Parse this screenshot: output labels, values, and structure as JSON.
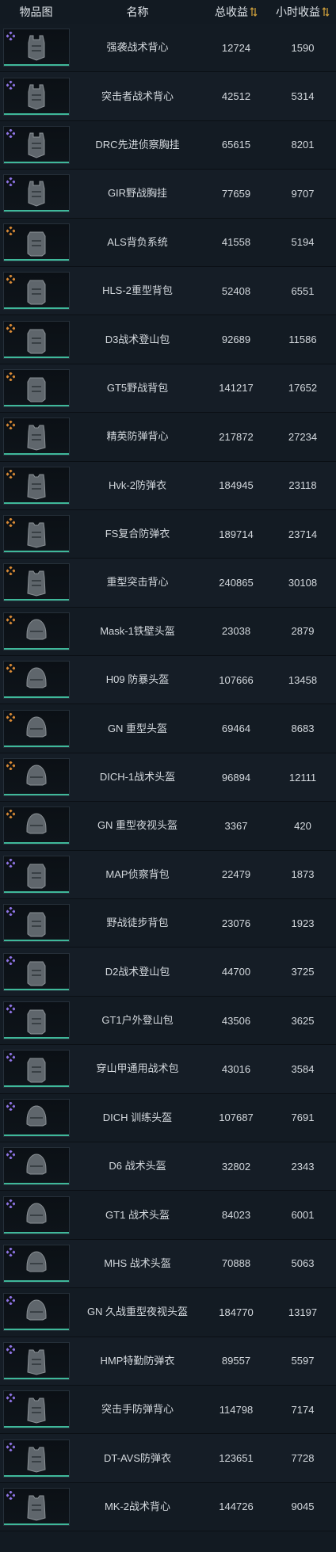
{
  "header": {
    "col_image": "物品图",
    "col_name": "名称",
    "col_total": "总收益",
    "col_hourly": "小时收益"
  },
  "colors": {
    "purple_rarity": "#8f74e6",
    "gold_rarity": "#d98a35",
    "accent_line": "#3fb89a",
    "sort_arrow": "#c79a3a"
  },
  "items": [
    {
      "name": "强袭战术背心",
      "total": "12724",
      "hourly": "1590",
      "rarity": "purple",
      "icon": "vest-icon"
    },
    {
      "name": "突击者战术背心",
      "total": "42512",
      "hourly": "5314",
      "rarity": "purple",
      "icon": "vest-icon"
    },
    {
      "name": "DRC先进侦察胸挂",
      "total": "65615",
      "hourly": "8201",
      "rarity": "purple",
      "icon": "vest-icon"
    },
    {
      "name": "GIR野战胸挂",
      "total": "77659",
      "hourly": "9707",
      "rarity": "purple",
      "icon": "vest-icon"
    },
    {
      "name": "ALS背负系统",
      "total": "41558",
      "hourly": "5194",
      "rarity": "gold",
      "icon": "backpack-icon"
    },
    {
      "name": "HLS-2重型背包",
      "total": "52408",
      "hourly": "6551",
      "rarity": "gold",
      "icon": "backpack-icon"
    },
    {
      "name": "D3战术登山包",
      "total": "92689",
      "hourly": "11586",
      "rarity": "gold",
      "icon": "backpack-icon"
    },
    {
      "name": "GT5野战背包",
      "total": "141217",
      "hourly": "17652",
      "rarity": "gold",
      "icon": "backpack-icon"
    },
    {
      "name": "精英防弹背心",
      "total": "217872",
      "hourly": "27234",
      "rarity": "gold",
      "icon": "armor-icon"
    },
    {
      "name": "Hvk-2防弹衣",
      "total": "184945",
      "hourly": "23118",
      "rarity": "gold",
      "icon": "armor-icon"
    },
    {
      "name": "FS复合防弹衣",
      "total": "189714",
      "hourly": "23714",
      "rarity": "gold",
      "icon": "armor-icon"
    },
    {
      "name": "重型突击背心",
      "total": "240865",
      "hourly": "30108",
      "rarity": "gold",
      "icon": "armor-icon"
    },
    {
      "name": "Mask-1铁壁头盔",
      "total": "23038",
      "hourly": "2879",
      "rarity": "gold",
      "icon": "helmet-icon"
    },
    {
      "name": "H09 防暴头盔",
      "total": "107666",
      "hourly": "13458",
      "rarity": "gold",
      "icon": "helmet-icon"
    },
    {
      "name": "GN 重型头盔",
      "total": "69464",
      "hourly": "8683",
      "rarity": "gold",
      "icon": "helmet-icon"
    },
    {
      "name": "DICH-1战术头盔",
      "total": "96894",
      "hourly": "12111",
      "rarity": "gold",
      "icon": "helmet-icon"
    },
    {
      "name": "GN 重型夜视头盔",
      "total": "3367",
      "hourly": "420",
      "rarity": "gold",
      "icon": "helmet-icon"
    },
    {
      "name": "MAP侦察背包",
      "total": "22479",
      "hourly": "1873",
      "rarity": "purple",
      "icon": "backpack-icon"
    },
    {
      "name": "野战徒步背包",
      "total": "23076",
      "hourly": "1923",
      "rarity": "purple",
      "icon": "backpack-icon"
    },
    {
      "name": "D2战术登山包",
      "total": "44700",
      "hourly": "3725",
      "rarity": "purple",
      "icon": "backpack-icon"
    },
    {
      "name": "GT1户外登山包",
      "total": "43506",
      "hourly": "3625",
      "rarity": "purple",
      "icon": "backpack-icon"
    },
    {
      "name": "穿山甲通用战术包",
      "total": "43016",
      "hourly": "3584",
      "rarity": "purple",
      "icon": "backpack-icon"
    },
    {
      "name": "DICH 训练头盔",
      "total": "107687",
      "hourly": "7691",
      "rarity": "purple",
      "icon": "helmet-icon"
    },
    {
      "name": "D6 战术头盔",
      "total": "32802",
      "hourly": "2343",
      "rarity": "purple",
      "icon": "helmet-icon"
    },
    {
      "name": "GT1 战术头盔",
      "total": "84023",
      "hourly": "6001",
      "rarity": "purple",
      "icon": "helmet-icon"
    },
    {
      "name": "MHS 战术头盔",
      "total": "70888",
      "hourly": "5063",
      "rarity": "purple",
      "icon": "helmet-icon"
    },
    {
      "name": "GN 久战重型夜视头盔",
      "total": "184770",
      "hourly": "13197",
      "rarity": "purple",
      "icon": "helmet-icon"
    },
    {
      "name": "HMP特勤防弹衣",
      "total": "89557",
      "hourly": "5597",
      "rarity": "purple",
      "icon": "armor-icon"
    },
    {
      "name": "突击手防弹背心",
      "total": "114798",
      "hourly": "7174",
      "rarity": "purple",
      "icon": "armor-icon"
    },
    {
      "name": "DT-AVS防弹衣",
      "total": "123651",
      "hourly": "7728",
      "rarity": "purple",
      "icon": "armor-icon"
    },
    {
      "name": "MK-2战术背心",
      "total": "144726",
      "hourly": "9045",
      "rarity": "purple",
      "icon": "armor-icon"
    }
  ]
}
